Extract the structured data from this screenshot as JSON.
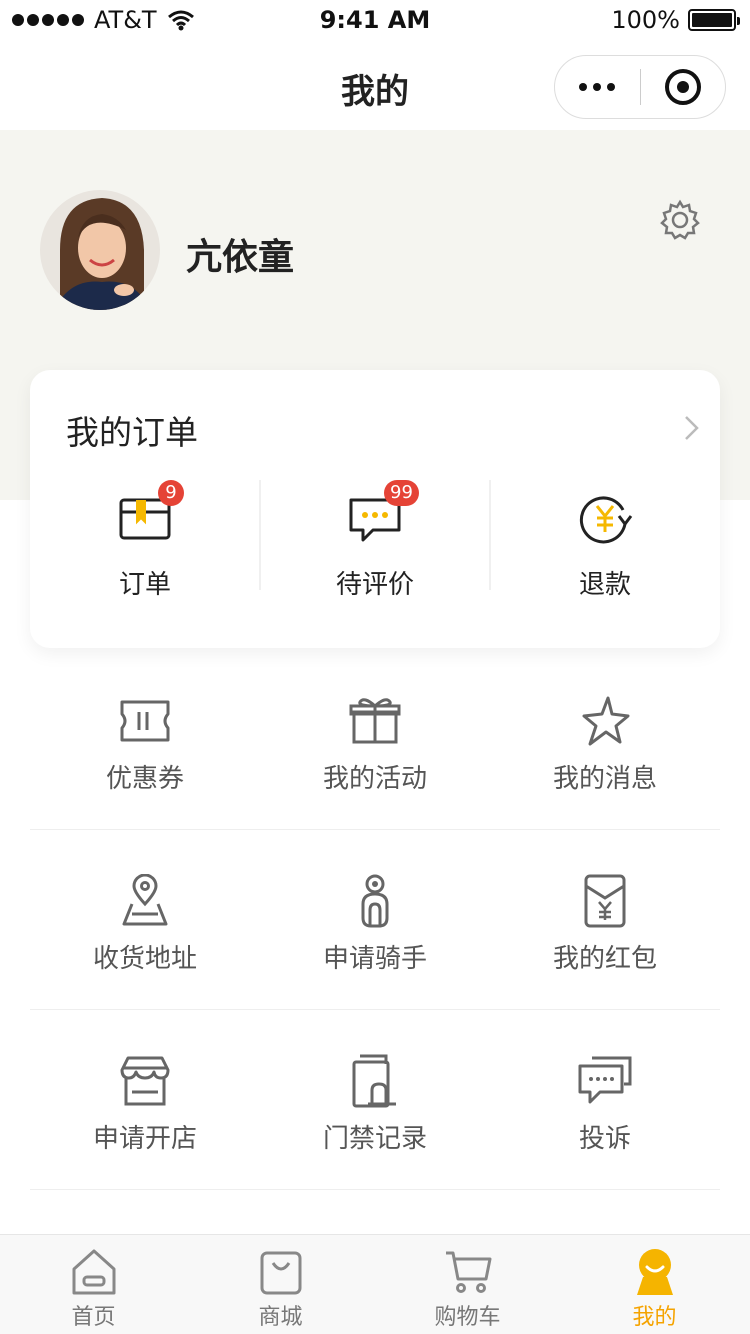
{
  "status_bar": {
    "carrier": "AT&T",
    "time": "9:41 AM",
    "battery": "100%"
  },
  "nav": {
    "title": "我的"
  },
  "profile": {
    "name": "亢依童"
  },
  "orders": {
    "title": "我的订单",
    "items": [
      {
        "label": "订单",
        "badge": "9",
        "icon": "order-box-icon"
      },
      {
        "label": "待评价",
        "badge": "99",
        "icon": "comment-bubble-icon"
      },
      {
        "label": "退款",
        "badge": "",
        "icon": "refund-yen-icon"
      }
    ]
  },
  "menu": {
    "rows": [
      [
        {
          "label": "优惠券",
          "icon": "coupon-icon"
        },
        {
          "label": "我的活动",
          "icon": "gift-icon"
        },
        {
          "label": "我的消息",
          "icon": "star-icon"
        }
      ],
      [
        {
          "label": "收货地址",
          "icon": "location-map-icon"
        },
        {
          "label": "申请骑手",
          "icon": "rider-icon"
        },
        {
          "label": "我的红包",
          "icon": "red-envelope-icon"
        }
      ],
      [
        {
          "label": "申请开店",
          "icon": "store-icon"
        },
        {
          "label": "门禁记录",
          "icon": "door-access-icon"
        },
        {
          "label": "投诉",
          "icon": "complaint-chat-icon"
        }
      ]
    ]
  },
  "tabbar": {
    "items": [
      {
        "label": "首页",
        "icon": "home-icon"
      },
      {
        "label": "商城",
        "icon": "shopping-bag-icon"
      },
      {
        "label": "购物车",
        "icon": "cart-icon"
      },
      {
        "label": "我的",
        "icon": "profile-icon"
      }
    ],
    "active_index": 3
  },
  "colors": {
    "accent": "#f5a300",
    "badge": "#e54336",
    "profile_bg": "#f5f5f0"
  }
}
